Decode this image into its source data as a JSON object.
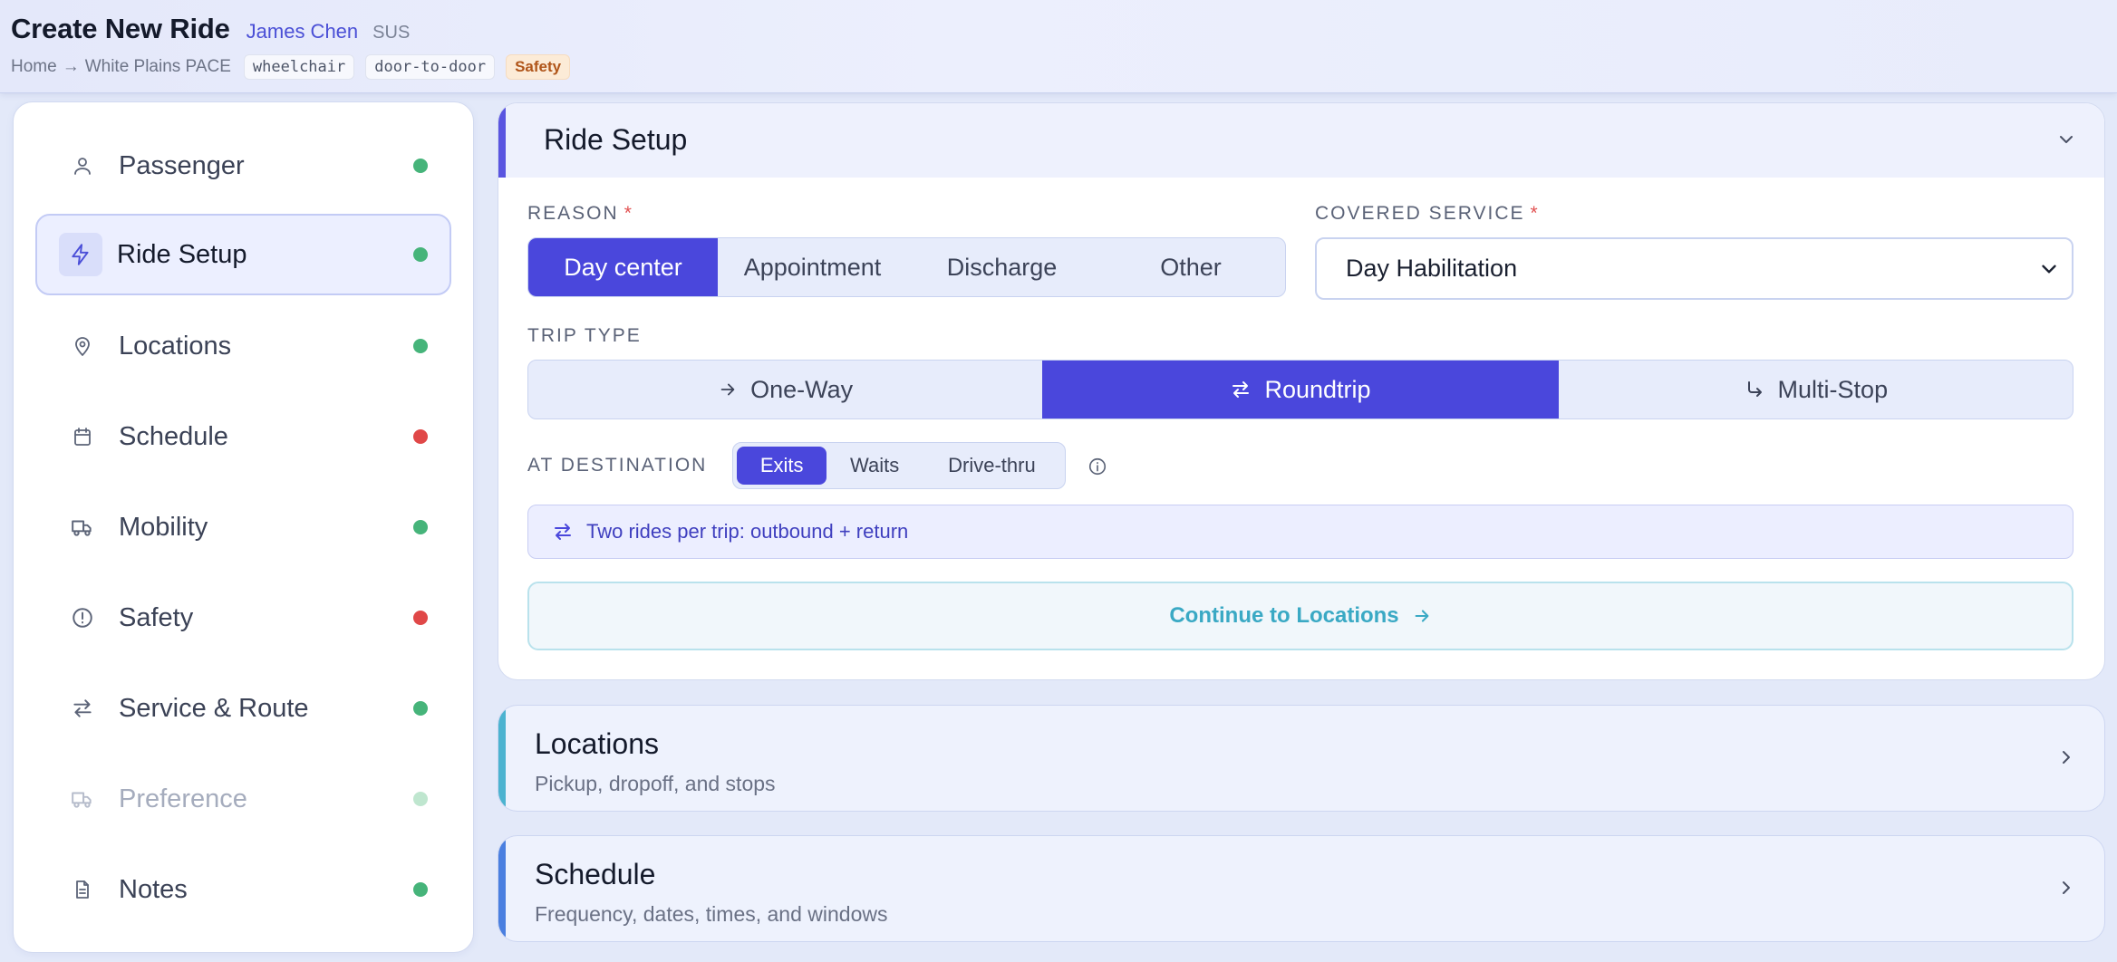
{
  "header": {
    "title": "Create New Ride",
    "user": "James Chen",
    "user_tag": "SUS",
    "breadcrumb": {
      "home": "Home",
      "arrow": "→",
      "current": "White Plains PACE"
    },
    "tags": [
      "wheelchair",
      "door-to-door",
      "Safety"
    ]
  },
  "sidebar": {
    "items": [
      {
        "label": "Passenger",
        "icon": "user-icon",
        "status": "complete"
      },
      {
        "label": "Ride Setup",
        "icon": "lightning-icon",
        "status": "complete",
        "active": true
      },
      {
        "label": "Locations",
        "icon": "map-pin-icon",
        "status": "complete"
      },
      {
        "label": "Schedule",
        "icon": "calendar-icon",
        "status": "incomplete"
      },
      {
        "label": "Mobility",
        "icon": "truck-icon",
        "status": "complete"
      },
      {
        "label": "Safety",
        "icon": "alert-circle-icon",
        "status": "incomplete"
      },
      {
        "label": "Service & Route",
        "icon": "arrows-swap-icon",
        "status": "complete"
      },
      {
        "label": "Preference",
        "icon": "truck-icon",
        "status": "disabled"
      },
      {
        "label": "Notes",
        "icon": "document-icon",
        "status": "complete"
      }
    ]
  },
  "ride_setup": {
    "title": "Ride Setup",
    "reason": {
      "label": "REASON",
      "required_mark": "*",
      "options": [
        "Day center",
        "Appointment",
        "Discharge",
        "Other"
      ],
      "selected": "Day center"
    },
    "covered_service": {
      "label": "COVERED SERVICE",
      "required_mark": "*",
      "value": "Day Habilitation"
    },
    "trip_type": {
      "label": "TRIP TYPE",
      "options": [
        "One-Way",
        "Roundtrip",
        "Multi-Stop"
      ],
      "selected": "Roundtrip"
    },
    "at_destination": {
      "label": "AT DESTINATION",
      "options": [
        "Exits",
        "Waits",
        "Drive-thru"
      ],
      "selected": "Exits"
    },
    "note": "Two rides per trip: outbound + return",
    "continue_label": "Continue to Locations"
  },
  "cards": [
    {
      "title": "Locations",
      "subtitle": "Pickup, dropoff, and stops"
    },
    {
      "title": "Schedule",
      "subtitle": "Frequency, dates, times, and windows"
    }
  ],
  "colors": {
    "accent": "#4a47dc",
    "status_green": "#46b47a",
    "status_red": "#e04848",
    "continue_teal": "#3aa9c4",
    "locations_bar": "#4cb3d0",
    "schedule_bar": "#4a7fe0"
  }
}
